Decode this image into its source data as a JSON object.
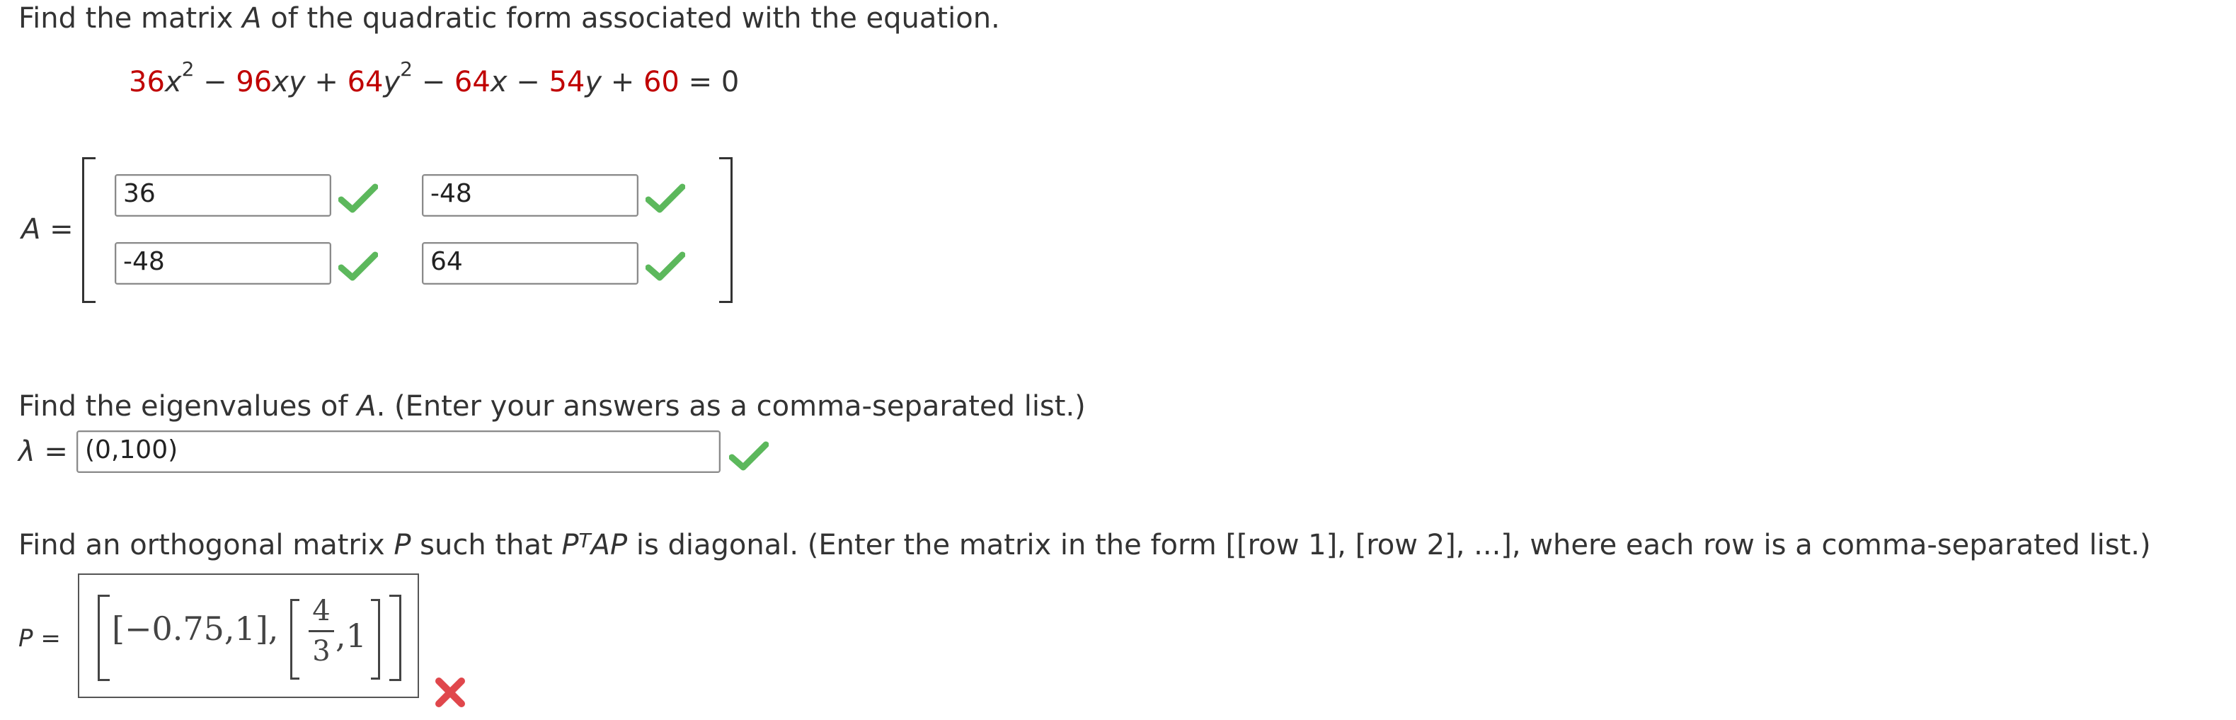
{
  "q1": {
    "prompt_before": "Find the matrix ",
    "prompt_var": "A",
    "prompt_after": " of the quadratic form associated with the equation."
  },
  "equation": {
    "c1": "36",
    "v1": "x",
    "e1": "2",
    "op1": "−",
    "c2": "96",
    "v2": "xy",
    "op2": "+",
    "c3": "64",
    "v3": "y",
    "e3": "2",
    "op3": "−",
    "c4": "64",
    "v4": "x",
    "op4": "−",
    "c5": "54",
    "v5": "y",
    "op5": "+",
    "c6": "60",
    "eq": "=",
    "rhs": "0"
  },
  "matrix_a": {
    "label_var": "A",
    "label_eq": "=",
    "a11": "36",
    "a12": "-48",
    "a21": "-48",
    "a22": "64",
    "a11_status": "correct",
    "a12_status": "correct",
    "a21_status": "correct",
    "a22_status": "correct"
  },
  "q2": {
    "prompt_before": "Find the eigenvalues of ",
    "prompt_var": "A",
    "prompt_after": ". (Enter your answers as a comma-separated list.)",
    "label_var": "λ",
    "label_eq": "=",
    "answer": "(0,100)",
    "status": "correct"
  },
  "q3": {
    "prompt_before": "Find an orthogonal matrix ",
    "prompt_var_p": "P",
    "prompt_mid": " such that ",
    "prompt_p": "P",
    "prompt_t": "T",
    "prompt_ap": "AP",
    "prompt_after": " is diagonal. (Enter the matrix in the form [[row 1], [row 2], ...], where each row is a comma-separated list.)",
    "label_var": "P",
    "label_eq": "=",
    "answer": {
      "row1_a": "−0.75",
      "row1_b": "1",
      "row2_num": "4",
      "row2_den": "3",
      "row2_b": "1"
    },
    "status": "incorrect"
  },
  "colors": {
    "coefficient_red": "#c00000",
    "check_green": "#5cb85c",
    "cross_red": "#e0474c",
    "text": "#333333"
  }
}
